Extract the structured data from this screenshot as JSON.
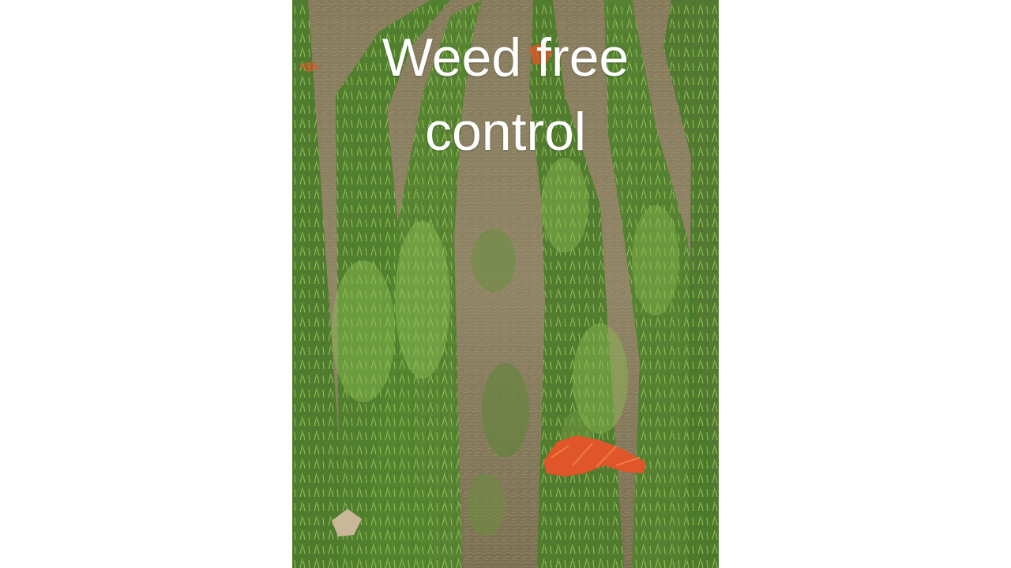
{
  "slide": {
    "title_lines": [
      "Weed free",
      "control"
    ]
  },
  "photo": {
    "subject": "rows of green cereal crop seedlings on bare soil with orange flagging marker",
    "colors": {
      "soil": "#8a7d60",
      "crop_dark": "#3f6b25",
      "crop_light": "#7fae48",
      "marker": "#e0562a"
    }
  }
}
